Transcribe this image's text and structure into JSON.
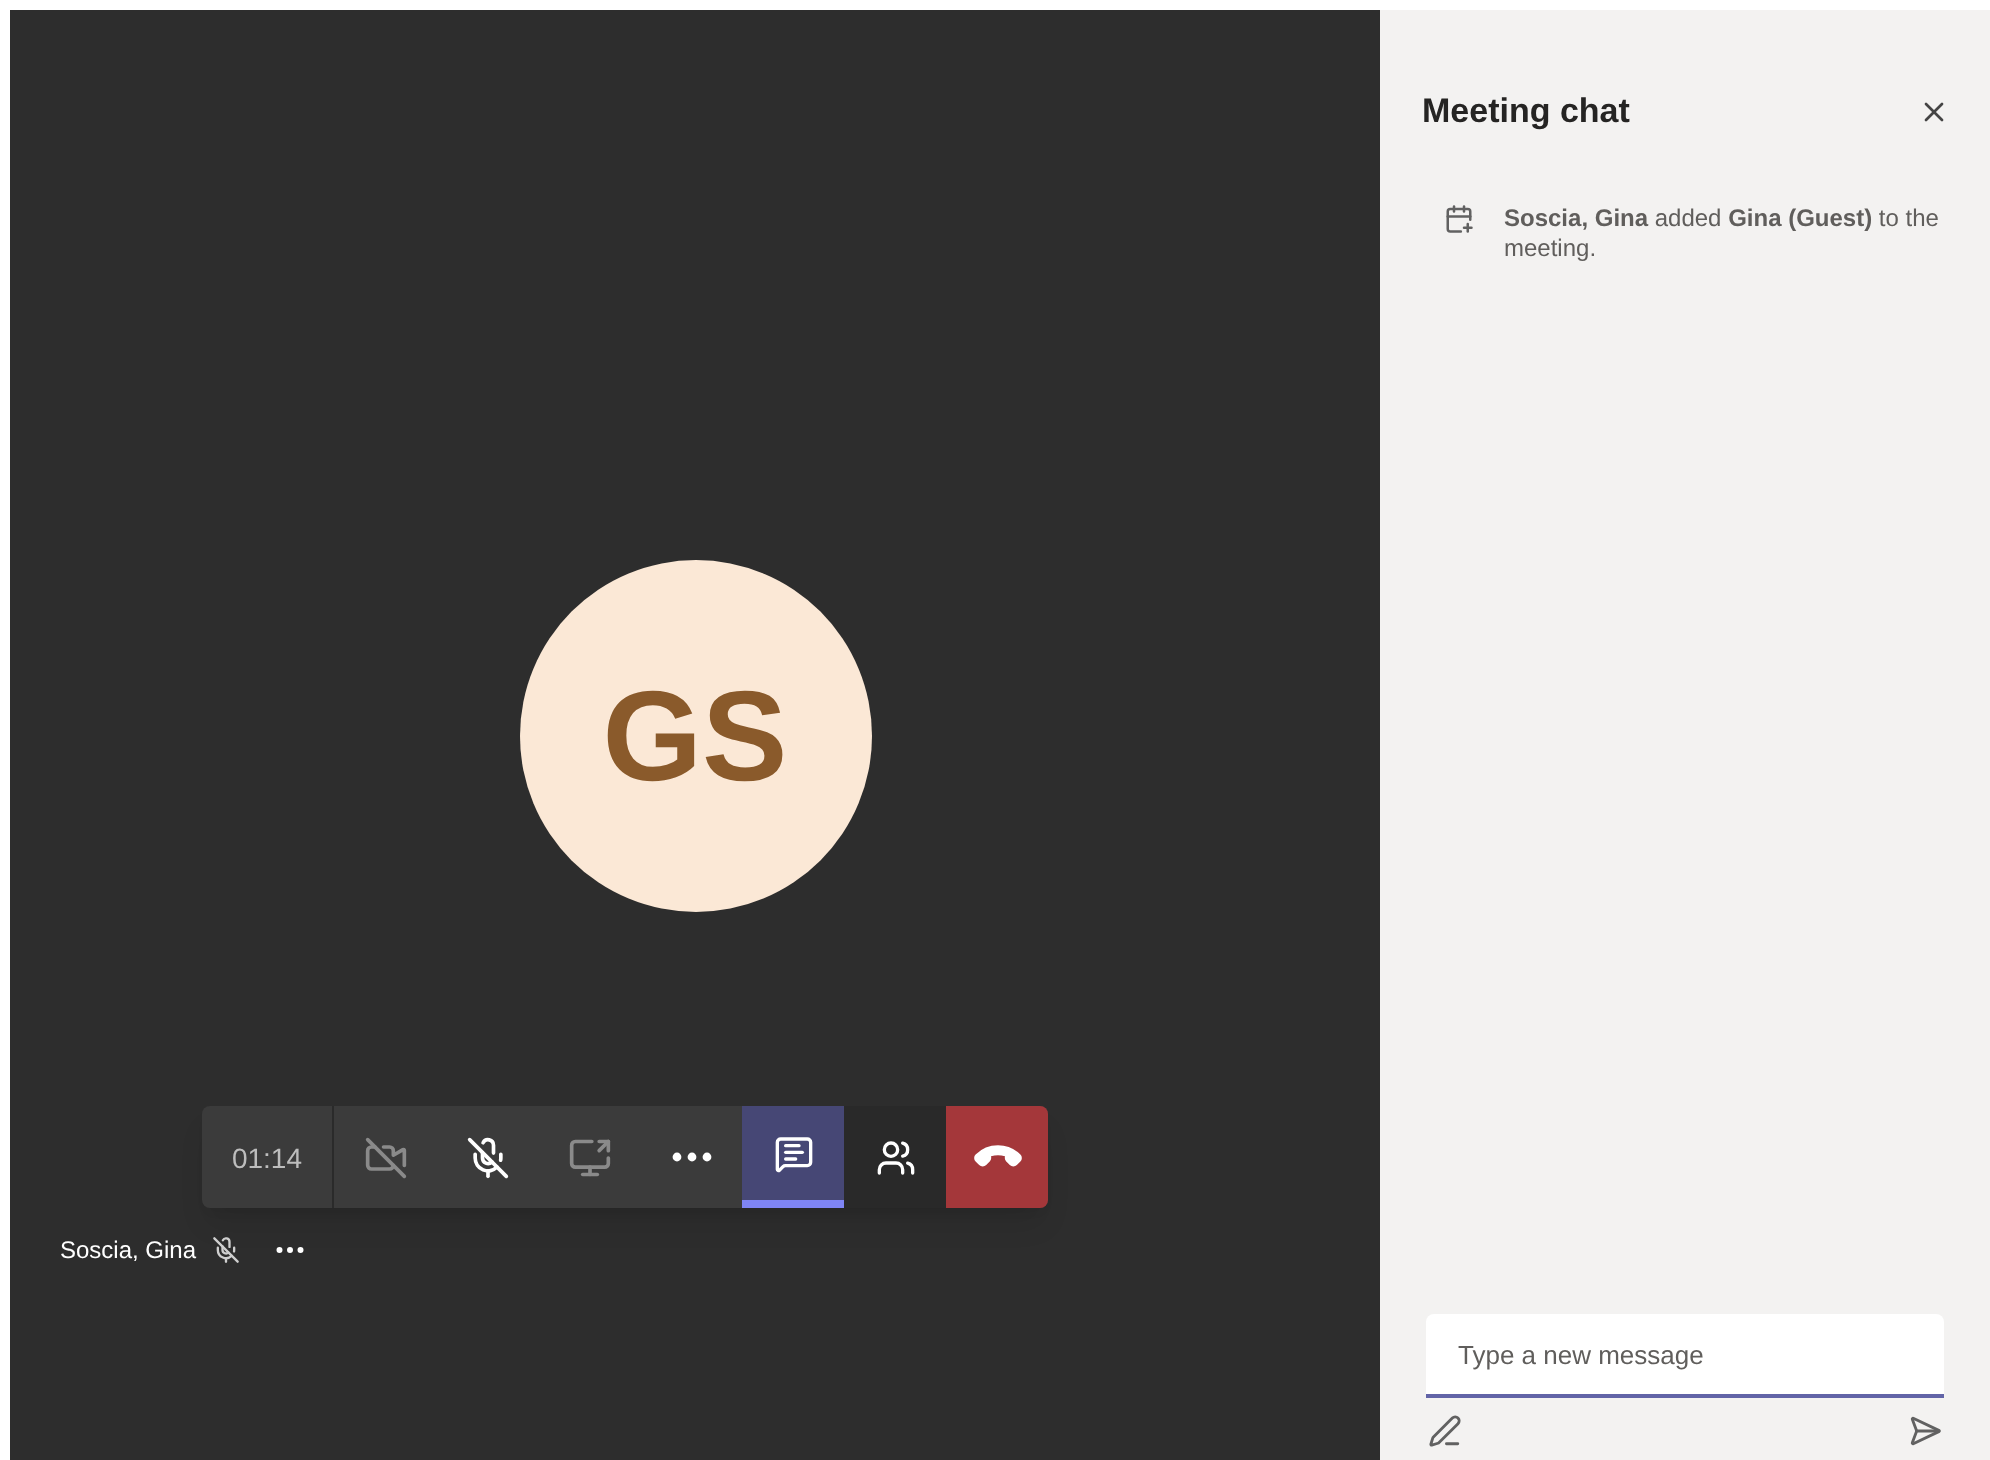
{
  "participant": {
    "initials": "GS",
    "name": "Soscia, Gina",
    "muted": true
  },
  "toolbar": [
    {
      "kind": "timer",
      "label": "01:14"
    },
    {
      "kind": "camera",
      "selected": false
    },
    {
      "kind": "mic",
      "selected": false
    },
    {
      "kind": "share",
      "selected": false
    },
    {
      "kind": "more",
      "selected": false
    },
    {
      "kind": "chat",
      "selected": true
    },
    {
      "kind": "people",
      "selected": false
    },
    {
      "kind": "hangup",
      "selected": false
    }
  ],
  "chat": {
    "title": "Meeting chat",
    "messages": [
      {
        "text": "**Soscia, Gina** added **Gina (Guest)** to the meeting."
      }
    ],
    "compose": {
      "placeholder": "Type a new message"
    }
  }
}
